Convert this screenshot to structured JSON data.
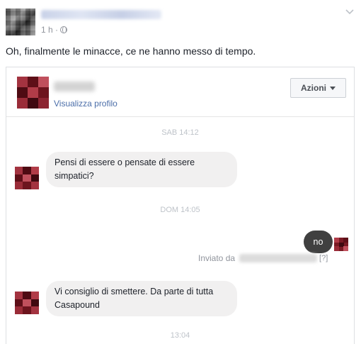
{
  "post": {
    "time": "1 h ·",
    "text": "Oh, finalmente le minacce, ce ne hanno messo di tempo."
  },
  "chat": {
    "profile_link": "Visualizza profilo",
    "actions_label": "Azioni",
    "timestamp_1": "SAB 14:12",
    "message_1": "Pensi di essere o pensate di essere simpatici?",
    "timestamp_2": "DOM 14:05",
    "reply": "no",
    "sent_by": "Inviato da",
    "sent_by_help": "[?]",
    "message_2": "Vi consiglio di smettere. Da parte di tutta Casapound",
    "timestamp_3": "13:04"
  }
}
